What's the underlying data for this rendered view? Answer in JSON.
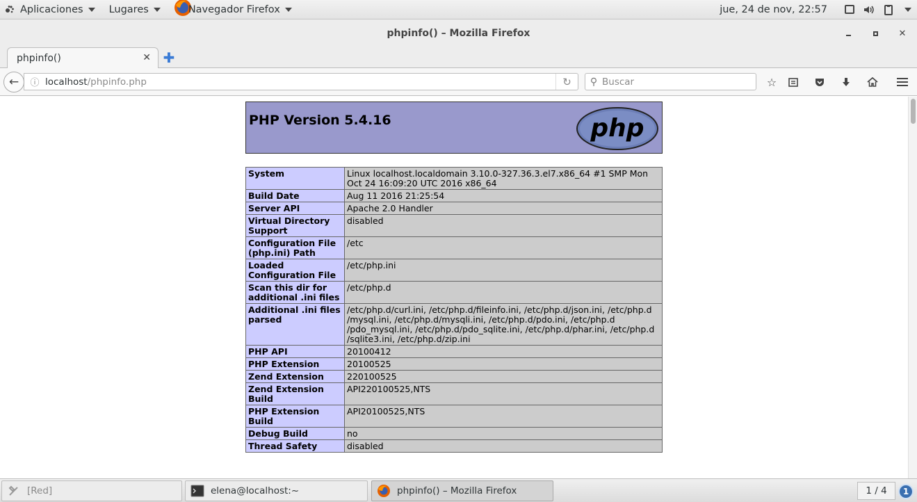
{
  "topbar": {
    "applications": "Aplicaciones",
    "places": "Lugares",
    "active_app": "Navegador Firefox",
    "clock": "jue, 24 de nov, 22:57"
  },
  "window": {
    "title": "phpinfo() – Mozilla Firefox"
  },
  "browser": {
    "tab_title": "phpinfo()",
    "url_host": "localhost",
    "url_path": "/phpinfo.php",
    "search_placeholder": "Buscar"
  },
  "page": {
    "heading": "PHP Version 5.4.16",
    "logo_text": "php",
    "rows": [
      {
        "key": "System",
        "value": "Linux localhost.localdomain 3.10.0-327.36.3.el7.x86_64 #1 SMP Mon Oct 24 16:09:20 UTC 2016 x86_64"
      },
      {
        "key": "Build Date",
        "value": "Aug 11 2016 21:25:54"
      },
      {
        "key": "Server API",
        "value": "Apache 2.0 Handler"
      },
      {
        "key": "Virtual Directory Support",
        "value": "disabled"
      },
      {
        "key": "Configuration File (php.ini) Path",
        "value": "/etc"
      },
      {
        "key": "Loaded Configuration File",
        "value": "/etc/php.ini"
      },
      {
        "key": "Scan this dir for additional .ini files",
        "value": "/etc/php.d"
      },
      {
        "key": "Additional .ini files parsed",
        "value": "/etc/php.d/curl.ini, /etc/php.d/fileinfo.ini, /etc/php.d/json.ini, /etc/php.d /mysql.ini, /etc/php.d/mysqli.ini, /etc/php.d/pdo.ini, /etc/php.d /pdo_mysql.ini, /etc/php.d/pdo_sqlite.ini, /etc/php.d/phar.ini, /etc/php.d /sqlite3.ini, /etc/php.d/zip.ini"
      },
      {
        "key": "PHP API",
        "value": "20100412"
      },
      {
        "key": "PHP Extension",
        "value": "20100525"
      },
      {
        "key": "Zend Extension",
        "value": "220100525"
      },
      {
        "key": "Zend Extension Build",
        "value": "API220100525,NTS"
      },
      {
        "key": "PHP Extension Build",
        "value": "API20100525,NTS"
      },
      {
        "key": "Debug Build",
        "value": "no"
      },
      {
        "key": "Thread Safety",
        "value": "disabled"
      }
    ]
  },
  "taskbar": {
    "items": [
      {
        "label": "[Red]"
      },
      {
        "label": "elena@localhost:~"
      },
      {
        "label": "phpinfo() – Mozilla Firefox"
      }
    ],
    "workspace": "1 / 4",
    "notifications": "1"
  }
}
